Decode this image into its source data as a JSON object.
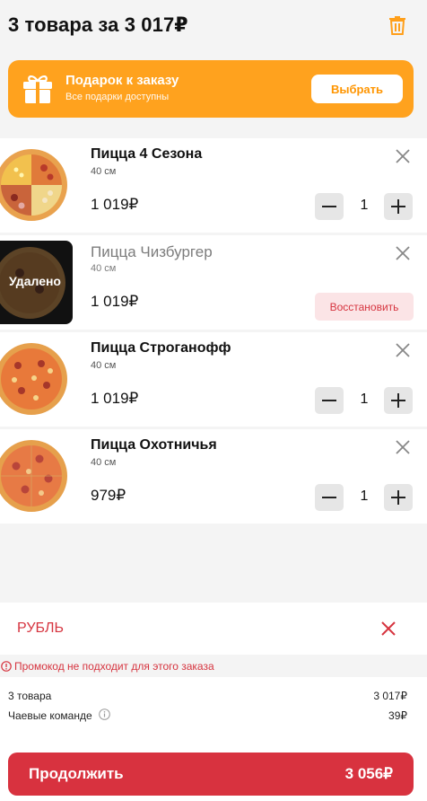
{
  "header": {
    "title": "3 товара за 3 017₽",
    "trash_icon": "trash-icon"
  },
  "gift": {
    "title": "Подарок к заказу",
    "subtitle": "Все подарки доступны",
    "button": "Выбрать",
    "icon": "gift-icon",
    "color": "#ffa21e"
  },
  "cart": {
    "items": [
      {
        "name": "Пицца 4 Сезона",
        "size": "40 см",
        "price": "1 019₽",
        "qty": "1"
      },
      {
        "name": "Пицца Чизбургер",
        "size": "40 см",
        "price": "1 019₽",
        "deleted_label": "Удалено",
        "restore": "Восстановить"
      },
      {
        "name": "Пицца Строганофф",
        "size": "40 см",
        "price": "1 019₽",
        "qty": "1"
      },
      {
        "name": "Пицца Охотничья",
        "size": "40 см",
        "price": "979₽",
        "qty": "1"
      }
    ]
  },
  "promo": {
    "code": "РУБЛЬ",
    "error": "Промокод не подходит для этого заказа"
  },
  "summary": {
    "items_label": "3 товара",
    "items_value": "3 017₽",
    "tips_label": "Чаевые команде",
    "tips_value": "39₽"
  },
  "checkout": {
    "label": "Продолжить",
    "total": "3 056₽",
    "color": "#d8323f"
  }
}
